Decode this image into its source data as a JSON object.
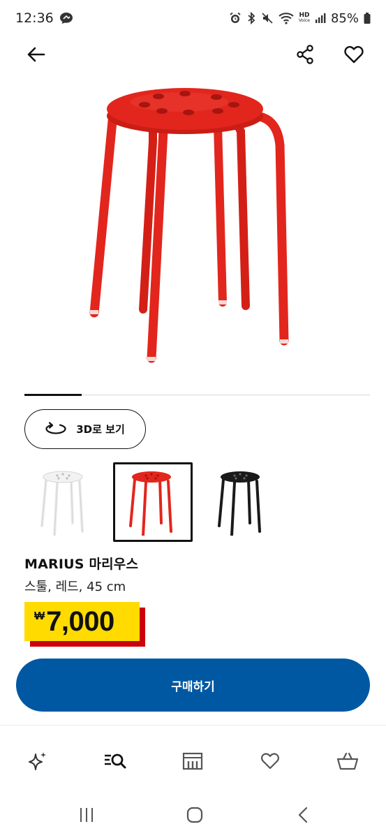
{
  "status_bar": {
    "time": "12:36",
    "network_badge_top": "HD",
    "network_badge_bottom": "Voice",
    "battery": "85%"
  },
  "top_bar": {
    "back_icon": "arrow-left-icon",
    "share_icon": "share-icon",
    "favorite_icon": "heart-outline-icon"
  },
  "product": {
    "name": "MARIUS 마리우스",
    "description": "스툴, 레드, 45 cm",
    "price_currency": "₩",
    "price_value": "7,000",
    "image_color": "#e2261d",
    "gallery": {
      "total_images": 6,
      "current_index": 1
    }
  },
  "view_3d": {
    "label": "3D로 보기",
    "icon": "rotate-3d-icon"
  },
  "variants": [
    {
      "color": "#ffffff",
      "selected": false,
      "icon": "stool-white-thumbnail"
    },
    {
      "color": "#e2261d",
      "selected": true,
      "icon": "stool-red-thumbnail"
    },
    {
      "color": "#1a1a1a",
      "selected": false,
      "icon": "stool-black-thumbnail"
    }
  ],
  "buy_button": {
    "label": "구매하기"
  },
  "colors": {
    "brand_blue": "#0058a3",
    "price_yellow": "#ffdb00",
    "price_red": "#cc0008"
  },
  "bottom_nav": [
    {
      "icon": "sparkle-icon"
    },
    {
      "icon": "search-list-icon"
    },
    {
      "icon": "store-icon"
    },
    {
      "icon": "heart-icon"
    },
    {
      "icon": "basket-icon"
    }
  ],
  "system_nav": [
    {
      "icon": "recent-apps-icon"
    },
    {
      "icon": "home-icon"
    },
    {
      "icon": "back-chevron-icon"
    }
  ]
}
